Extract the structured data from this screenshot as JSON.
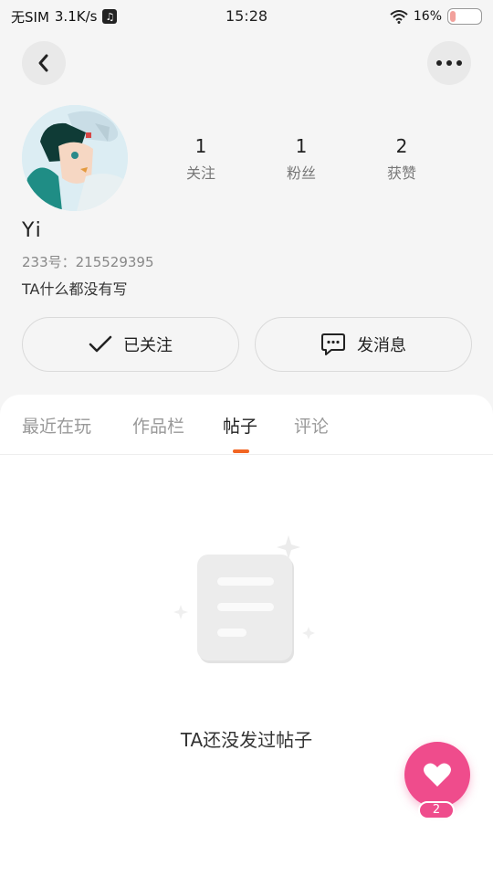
{
  "status_bar": {
    "carrier": "无SIM",
    "speed": "3.1K/s",
    "time": "15:28",
    "battery": "16%"
  },
  "nav": {
    "back_icon": "chevron-left-icon",
    "more_icon": "more-horizontal-icon"
  },
  "profile": {
    "username": "Yi",
    "id_label": "233号：215529395",
    "bio": "TA什么都没有写",
    "stats": [
      {
        "value": "1",
        "label": "关注"
      },
      {
        "value": "1",
        "label": "粉丝"
      },
      {
        "value": "2",
        "label": "获赞"
      }
    ]
  },
  "actions": {
    "follow_label": "已关注",
    "message_label": "发消息"
  },
  "tabs": [
    {
      "label": "最近在玩",
      "active": false
    },
    {
      "label": "作品栏",
      "active": false
    },
    {
      "label": "帖子",
      "active": true
    },
    {
      "label": "评论",
      "active": false
    }
  ],
  "empty_state": {
    "text": "TA还没发过帖子"
  },
  "like": {
    "count": "2"
  },
  "colors": {
    "accent": "#f26522",
    "like": "#ef4c8c",
    "background": "#f5f5f5"
  }
}
